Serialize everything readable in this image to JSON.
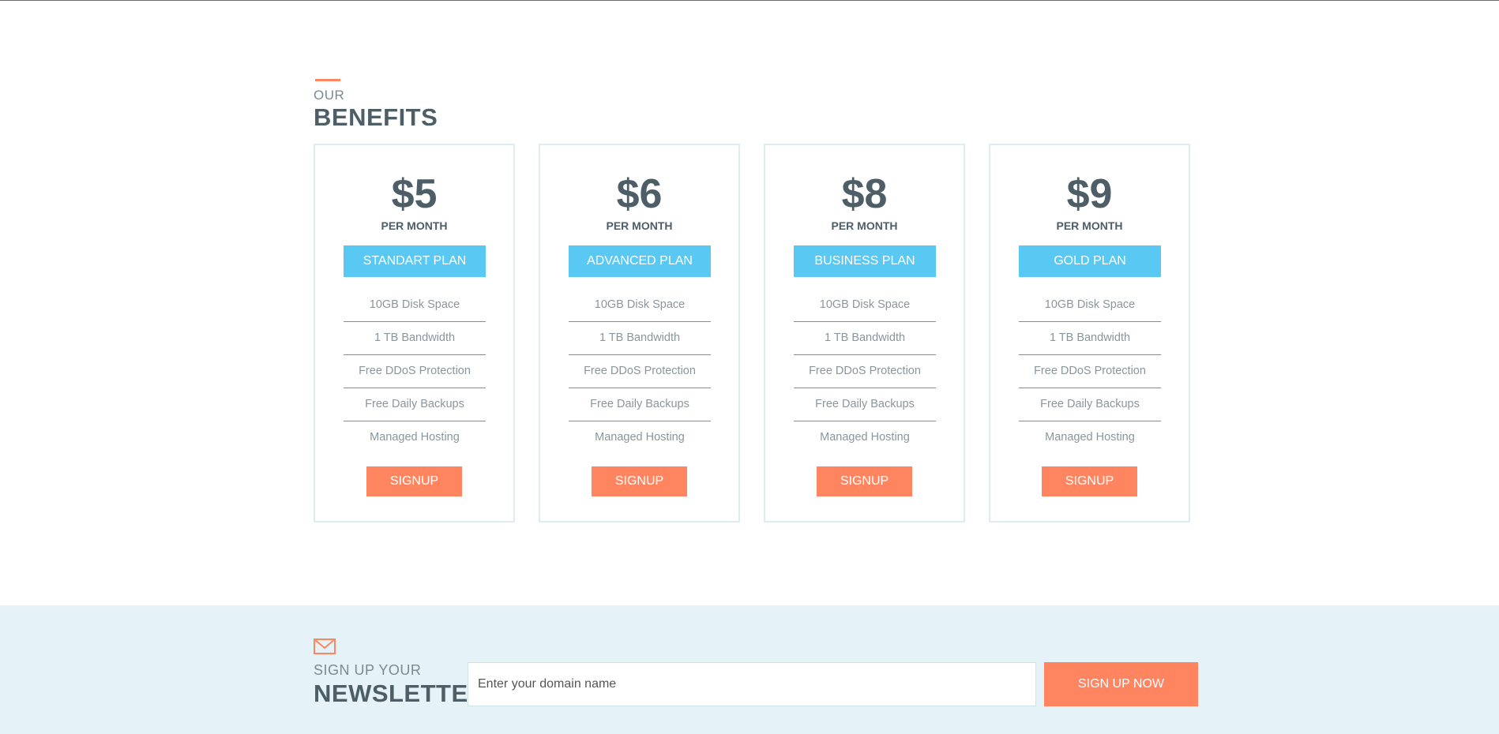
{
  "benefits": {
    "kicker": "OUR",
    "title": "BENEFITS"
  },
  "plans": [
    {
      "price": "$5",
      "period": "PER MONTH",
      "name": "STANDART PLAN",
      "features": [
        "10GB Disk Space",
        "1 TB Bandwidth",
        "Free DDoS Protection",
        "Free Daily Backups",
        "Managed Hosting"
      ],
      "signup_label": "SIGNUP"
    },
    {
      "price": "$6",
      "period": "PER MONTH",
      "name": "ADVANCED PLAN",
      "features": [
        "10GB Disk Space",
        "1 TB Bandwidth",
        "Free DDoS Protection",
        "Free Daily Backups",
        "Managed Hosting"
      ],
      "signup_label": "SIGNUP"
    },
    {
      "price": "$8",
      "period": "PER MONTH",
      "name": "BUSINESS PLAN",
      "features": [
        "10GB Disk Space",
        "1 TB Bandwidth",
        "Free DDoS Protection",
        "Free Daily Backups",
        "Managed Hosting"
      ],
      "signup_label": "SIGNUP"
    },
    {
      "price": "$9",
      "period": "PER MONTH",
      "name": "GOLD PLAN",
      "features": [
        "10GB Disk Space",
        "1 TB Bandwidth",
        "Free DDoS Protection",
        "Free Daily Backups",
        "Managed Hosting"
      ],
      "signup_label": "SIGNUP"
    }
  ],
  "newsletter": {
    "icon": "envelope-icon",
    "kicker": "SIGN UP YOUR",
    "title": "NEWSLETTER",
    "input_placeholder": "Enter your domain name",
    "input_value": "",
    "button_label": "SIGN UP NOW"
  },
  "colors": {
    "accent": "#ff8560",
    "plan_header": "#59c8f2",
    "heading_text": "#4d5e67",
    "card_border": "#dcecf1",
    "newsletter_bg": "#e5f3f8"
  }
}
